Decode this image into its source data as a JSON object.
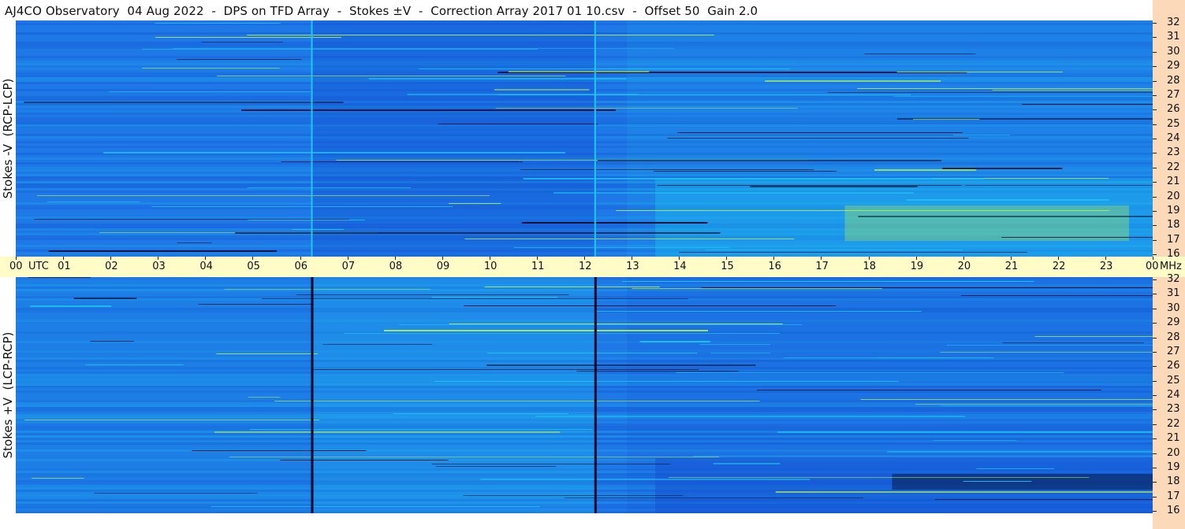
{
  "title": "AJ4CO Observatory  04 Aug 2022  -  DPS on TFD Array  -  Stokes ±V  -  Correction Array 2017 01 10.csv  -  Offset 50  Gain 2.0",
  "colors": {
    "background_blue": "#1e78e6",
    "deep_blue": "#1450d2",
    "bright_cyan": "#1ec8f0",
    "green_yellow": "#b4f050",
    "black_line": "#050a28",
    "time_axis_bg": "#fffcc8",
    "freq_axis_bg": "#fcd9b8"
  },
  "chart_data": [
    {
      "type": "heatmap",
      "panel": "top",
      "ylabel": "Stokes -V  (RCP-LCP)",
      "xlabel": "UTC",
      "x_range_utc_hours": [
        0,
        24
      ],
      "y_range_mhz": [
        16,
        32
      ],
      "y_ticks_mhz": [
        "16",
        "17",
        "18",
        "19",
        "20",
        "21",
        "22",
        "23",
        "24",
        "25",
        "26",
        "27",
        "28",
        "29",
        "30",
        "31",
        "32"
      ],
      "y_unit": "",
      "vertical_marker_lines_utc": [
        6.25,
        12.23
      ],
      "marker_line_color": "cyan"
    },
    {
      "type": "heatmap",
      "panel": "bottom",
      "ylabel": "Stokes +V  (LCP-RCP)",
      "xlabel": "UTC",
      "x_range_utc_hours": [
        0,
        24
      ],
      "y_range_mhz": [
        16,
        32
      ],
      "y_ticks_mhz": [
        "16",
        "17",
        "18",
        "19",
        "20",
        "21",
        "22",
        "23",
        "24",
        "25",
        "26",
        "27",
        "28",
        "29",
        "30",
        "31",
        "32"
      ],
      "y_unit": "",
      "vertical_marker_lines_utc": [
        6.25,
        12.23
      ],
      "marker_line_color": "black"
    }
  ],
  "time_axis": {
    "labels": [
      "00",
      "01",
      "02",
      "03",
      "04",
      "05",
      "06",
      "07",
      "08",
      "09",
      "10",
      "11",
      "12",
      "13",
      "14",
      "15",
      "16",
      "17",
      "18",
      "19",
      "20",
      "21",
      "22",
      "23",
      "00"
    ],
    "utc_label": "UTC",
    "mhz_label": "MHz"
  },
  "freq_axis_unit_top": ""
}
